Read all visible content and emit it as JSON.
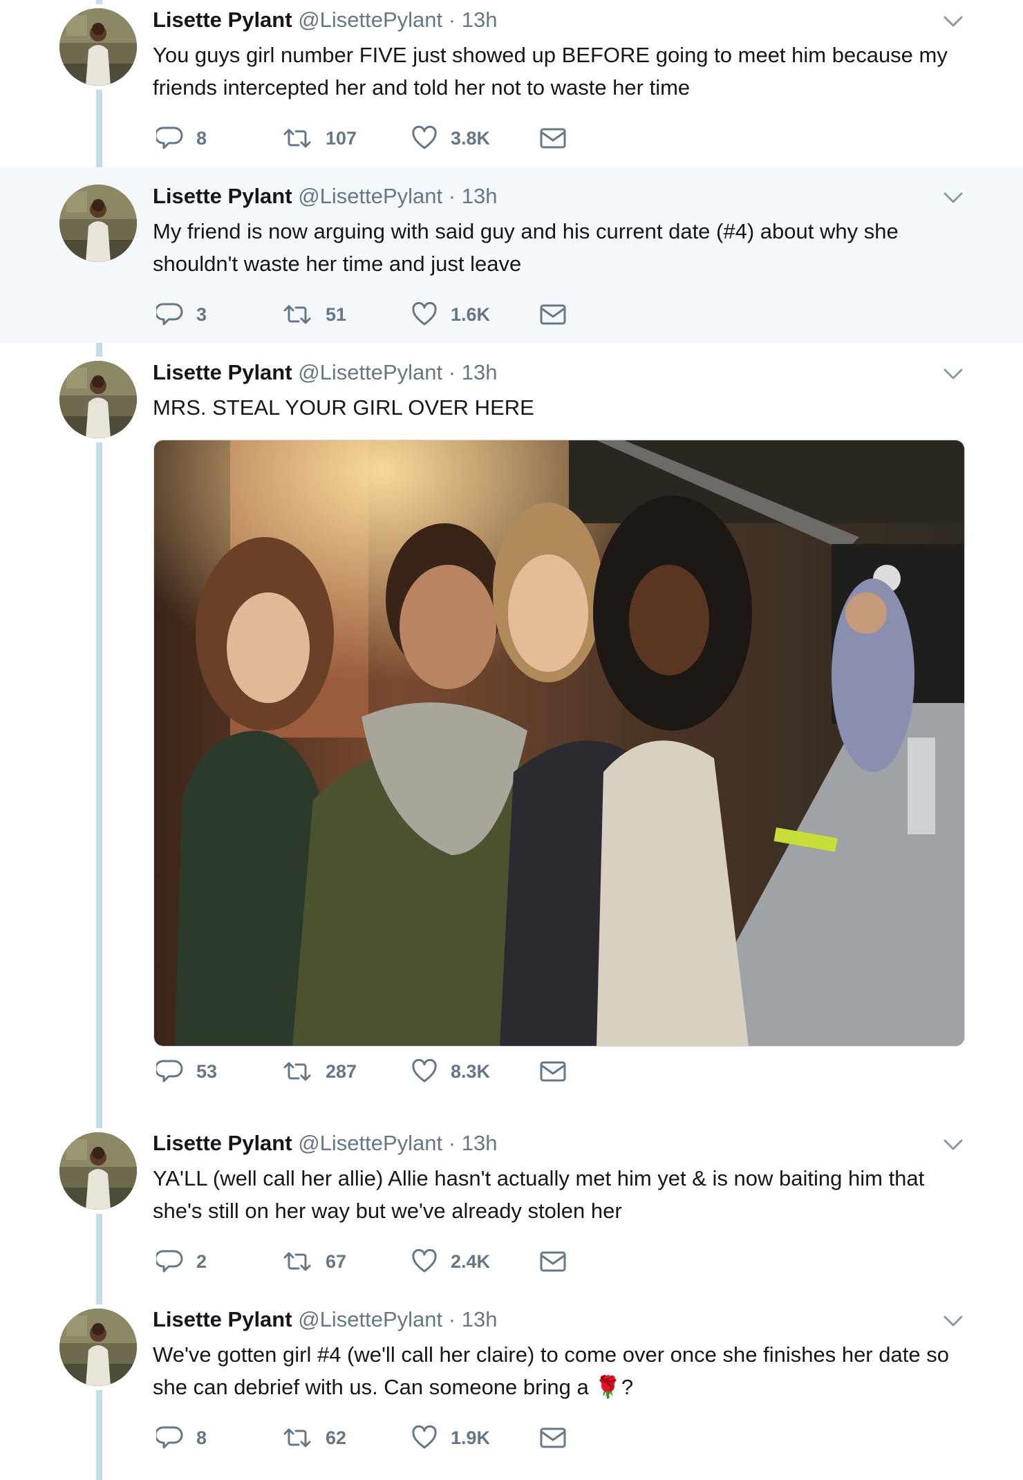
{
  "colors": {
    "accent": "#1da1f2",
    "thread_line": "#c4dde6",
    "muted": "#657786",
    "highlight_bg": "#f5f8fa"
  },
  "icons": [
    "reply-icon",
    "retweet-icon",
    "like-icon",
    "message-icon",
    "chevron-down-icon"
  ],
  "tweets": [
    {
      "name": "Lisette Pylant",
      "handle": "@LisettePylant",
      "separator": "·",
      "time": "13h",
      "text": "You guys girl number FIVE just showed up BEFORE going to meet him because my friends intercepted her and told her not to waste her time",
      "replies": "8",
      "retweets": "107",
      "likes": "3.8K"
    },
    {
      "name": "Lisette Pylant",
      "handle": "@LisettePylant",
      "separator": "·",
      "time": "13h",
      "text": "My friend is now arguing with said guy and his current date (#4) about why she shouldn't waste her time and just leave",
      "replies": "3",
      "retweets": "51",
      "likes": "1.6K"
    },
    {
      "name": "Lisette Pylant",
      "handle": "@LisettePylant",
      "separator": "·",
      "time": "13h",
      "text": "MRS. STEAL YOUR GIRL OVER HERE",
      "replies": "53",
      "retweets": "287",
      "likes": "8.3K"
    },
    {
      "name": "Lisette Pylant",
      "handle": "@LisettePylant",
      "separator": "·",
      "time": "13h",
      "text": "YA'LL (well call her allie) Allie hasn't actually met him yet & is now baiting him that she's still on her way but we've already stolen her",
      "replies": "2",
      "retweets": "67",
      "likes": "2.4K"
    },
    {
      "name": "Lisette Pylant",
      "handle": "@LisettePylant",
      "separator": "·",
      "time": "13h",
      "text": "We've gotten girl #4 (we'll call her claire) to come over once she finishes her date so she can debrief with us. Can someone bring a 🌹?",
      "replies": "8",
      "retweets": "62",
      "likes": "1.9K"
    }
  ]
}
